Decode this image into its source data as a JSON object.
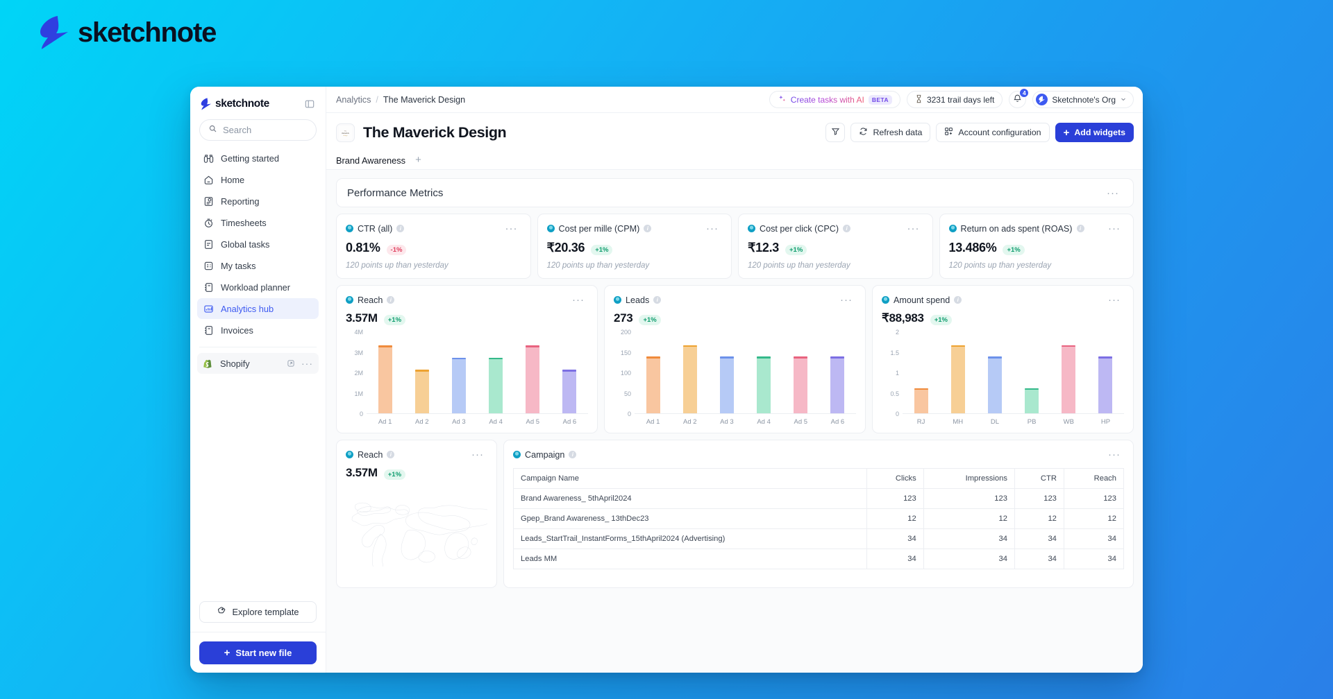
{
  "brand": {
    "name": "sketchnote",
    "logo_icon": "lightning-bolt-icon"
  },
  "sidebar": {
    "logo_text": "sketchnote",
    "collapse_icon": "panel-collapse-icon",
    "search": {
      "placeholder": "Search",
      "value": "",
      "icon": "search-icon"
    },
    "items": [
      {
        "label": "Getting started",
        "icon": "binoculars-icon",
        "active": false
      },
      {
        "label": "Home",
        "icon": "home-icon",
        "active": false
      },
      {
        "label": "Reporting",
        "icon": "report-icon",
        "active": false
      },
      {
        "label": "Timesheets",
        "icon": "stopwatch-icon",
        "active": false
      },
      {
        "label": "Global tasks",
        "icon": "list-icon",
        "active": false
      },
      {
        "label": "My tasks",
        "icon": "checklist-icon",
        "active": false
      },
      {
        "label": "Workload planner",
        "icon": "planner-icon",
        "active": false
      },
      {
        "label": "Analytics hub",
        "icon": "analytics-icon",
        "active": true
      },
      {
        "label": "Invoices",
        "icon": "invoice-icon",
        "active": false
      }
    ],
    "app": {
      "label": "Shopify",
      "icon": "shopify-icon",
      "open_icon": "external-link-icon",
      "more_icon": "more-icon"
    },
    "explore_template": {
      "label": "Explore template",
      "icon": "template-icon"
    },
    "start_new_file": {
      "label": "Start new file",
      "icon": "plus-icon"
    }
  },
  "topbar": {
    "breadcrumb": {
      "root": "Analytics",
      "separator": "/",
      "current": "The Maverick Design"
    },
    "ai_button": {
      "label": "Create tasks with AI",
      "badge": "BETA",
      "icon": "sparkle-icon"
    },
    "trial": {
      "label": "3231 trail days left",
      "icon": "hourglass-icon"
    },
    "notifications": {
      "count": "4",
      "icon": "bell-icon"
    },
    "org": {
      "name": "Sketchnote's Org",
      "avatar_icon": "bolt-avatar-icon",
      "chevron_icon": "chevron-down-icon"
    }
  },
  "header": {
    "doc_icon": "document-thumbnail-icon",
    "title": "The Maverick Design",
    "filter_button": {
      "icon": "filter-icon",
      "label": ""
    },
    "refresh_button": {
      "label": "Refresh data",
      "icon": "refresh-icon"
    },
    "account_config_button": {
      "label": "Account configuration",
      "icon": "widgets-icon"
    },
    "add_widgets_button": {
      "label": "Add widgets",
      "icon": "plus-icon"
    }
  },
  "tabs": {
    "items": [
      {
        "label": "Brand Awareness",
        "active": true
      }
    ],
    "add_label": "+"
  },
  "panel": {
    "title": "Performance Metrics",
    "more_icon": "more-icon"
  },
  "kpis": [
    {
      "name": "CTR (all)",
      "value": "0.81%",
      "delta": "-1%",
      "delta_dir": "down",
      "subtitle": "120 points up than yesterday"
    },
    {
      "name": "Cost per mille (CPM)",
      "value": "₹20.36",
      "delta": "+1%",
      "delta_dir": "up",
      "subtitle": "120 points up than yesterday"
    },
    {
      "name": "Cost per click (CPC)",
      "value": "₹12.3",
      "delta": "+1%",
      "delta_dir": "up",
      "subtitle": "120 points up than yesterday"
    },
    {
      "name": "Return on ads spent (ROAS)",
      "value": "13.486%",
      "delta": "+1%",
      "delta_dir": "up",
      "subtitle": "120 points up than yesterday"
    }
  ],
  "widgets": {
    "reach_chart": {
      "name": "Reach",
      "value": "3.57M",
      "delta": "+1%"
    },
    "leads_chart": {
      "name": "Leads",
      "value": "273",
      "delta": "+1%"
    },
    "spend_chart": {
      "name": "Amount spend",
      "value": "₹88,983",
      "delta": "+1%"
    },
    "reach_map": {
      "name": "Reach",
      "value": "3.57M",
      "delta": "+1%"
    },
    "campaign_table": {
      "name": "Campaign"
    }
  },
  "chart_data": [
    {
      "type": "bar",
      "title": "Reach",
      "categories": [
        "Ad 1",
        "Ad 2",
        "Ad 3",
        "Ad 4",
        "Ad 5",
        "Ad 6"
      ],
      "values": [
        3.35,
        2.15,
        2.75,
        2.75,
        3.35,
        2.15
      ],
      "tick_labels": [
        "4M",
        "3M",
        "2M",
        "1M",
        "0"
      ],
      "ticks": [
        4,
        3,
        2,
        1,
        0
      ],
      "ylim": [
        0,
        4
      ],
      "xlabel": "",
      "ylabel": "",
      "grid": false,
      "legend": "none",
      "colors": [
        "#f9c6a0",
        "#f7cf95",
        "#b6caf6",
        "#a9e8ce",
        "#f6b8c6",
        "#bdb8f3"
      ],
      "cap_colors": [
        "#ef8b3c",
        "#eda231",
        "#6d91ea",
        "#35b98a",
        "#e8637f",
        "#7c6fe3"
      ]
    },
    {
      "type": "bar",
      "title": "Leads",
      "categories": [
        "Ad 1",
        "Ad 2",
        "Ad 3",
        "Ad 4",
        "Ad 5",
        "Ad 6"
      ],
      "values": [
        140,
        168,
        140,
        140,
        140,
        140
      ],
      "tick_labels": [
        "200",
        "150",
        "100",
        "50",
        "0"
      ],
      "ticks": [
        200,
        150,
        100,
        50,
        0
      ],
      "ylim": [
        0,
        200
      ],
      "xlabel": "",
      "ylabel": "",
      "grid": false,
      "legend": "none",
      "colors": [
        "#f9c6a0",
        "#f7cf95",
        "#b6caf6",
        "#a9e8ce",
        "#f6b8c6",
        "#bdb8f3"
      ],
      "cap_colors": [
        "#ef8b3c",
        "#eda231",
        "#6d91ea",
        "#35b98a",
        "#e8637f",
        "#7c6fe3"
      ]
    },
    {
      "type": "bar",
      "title": "Amount spend",
      "categories": [
        "RJ",
        "MH",
        "DL",
        "PB",
        "WB",
        "HP"
      ],
      "values": [
        0.62,
        1.68,
        1.4,
        0.62,
        1.68,
        1.4
      ],
      "tick_labels": [
        "2",
        "1.5",
        "1",
        "0.5",
        "0"
      ],
      "ticks": [
        2,
        1.5,
        1,
        0.5,
        0
      ],
      "ylim": [
        0,
        2
      ],
      "xlabel": "",
      "ylabel": "",
      "grid": false,
      "legend": "none",
      "colors": [
        "#f9c6a0",
        "#f7cf95",
        "#b6caf6",
        "#a9e8ce",
        "#f6b8c6",
        "#bdb8f3"
      ],
      "cap_colors": [
        "#ef8b3c",
        "#eda231",
        "#6d91ea",
        "#35b98a",
        "#e8637f",
        "#7c6fe3"
      ]
    }
  ],
  "table": {
    "columns": [
      "Campaign Name",
      "Clicks",
      "Impressions",
      "CTR",
      "Reach"
    ],
    "rows": [
      [
        "Brand Awareness_ 5thApril2024",
        "123",
        "123",
        "123",
        "123"
      ],
      [
        "Gpep_Brand Awareness_ 13thDec23",
        "12",
        "12",
        "12",
        "12"
      ],
      [
        "Leads_StartTrail_InstantForms_15thApril2024 (Advertising)",
        "34",
        "34",
        "34",
        "34"
      ],
      [
        "Leads MM",
        "34",
        "34",
        "34",
        "34"
      ]
    ]
  },
  "colors": {
    "accent": "#2a3fd8",
    "active_nav": "#3d5af1",
    "up": "#0f9d6e",
    "down": "#e0415f",
    "bg": "#12b6f5"
  }
}
